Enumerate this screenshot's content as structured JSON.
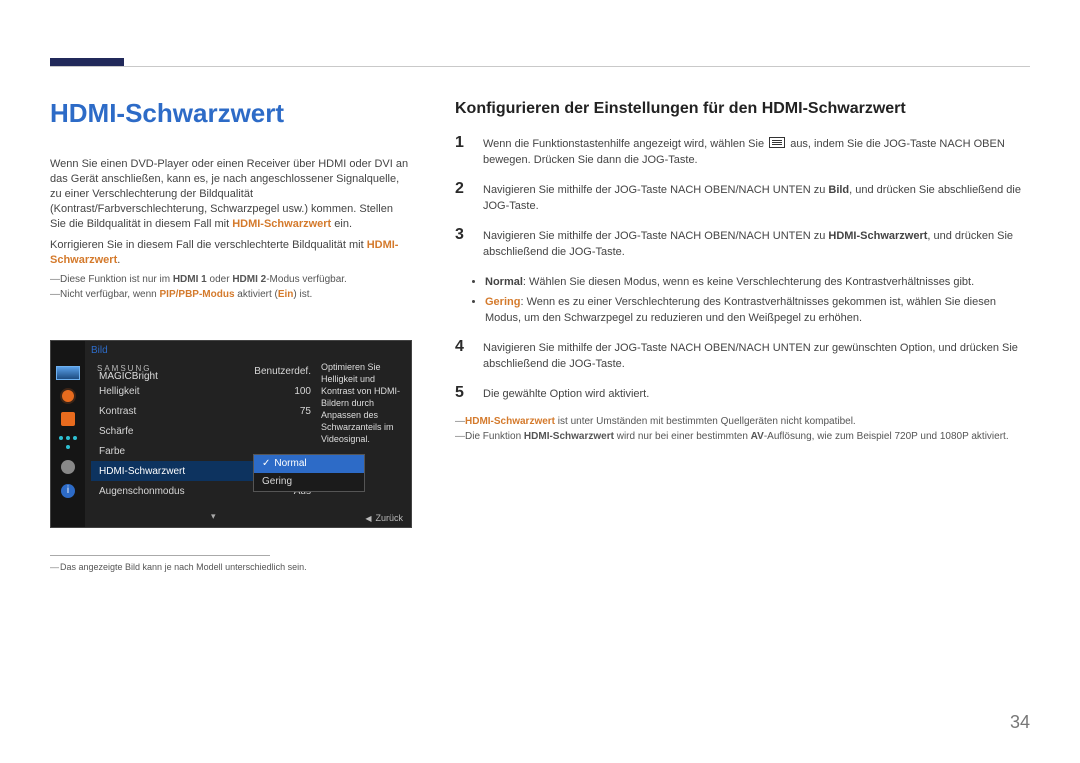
{
  "page_number": "34",
  "left": {
    "title": "HDMI-Schwarzwert",
    "intro": "Wenn Sie einen DVD-Player oder einen Receiver über HDMI oder DVI an das Gerät anschließen, kann es, je nach angeschlossener Signalquelle, zu einer Verschlechterung der Bildqualität (Kontrast/Farbverschlechterung, Schwarzpegel usw.) kommen. Stellen Sie die Bildqualität in diesem Fall mit ",
    "intro_hl": "HDMI-Schwarzwert",
    "intro_tail": " ein.",
    "intro2_a": "Korrigieren Sie in diesem Fall die verschlechterte Bildqualität mit ",
    "intro2_hl": "HDMI-Schwarzwert",
    "intro2_tail": ".",
    "note1_a": "Diese Funktion ist nur im ",
    "note1_b": "HDMI 1",
    "note1_c": " oder ",
    "note1_d": "HDMI 2",
    "note1_e": "-Modus verfügbar.",
    "note2_a": "Nicht verfügbar, wenn ",
    "note2_b": "PIP/PBP-Modus",
    "note2_c": " aktiviert (",
    "note2_d": "Ein",
    "note2_e": ") ist.",
    "caption": "Das angezeigte Bild kann je nach Modell unterschiedlich sein."
  },
  "osd": {
    "title": "Bild",
    "magic_brand": "SAMSUNG",
    "magic": "MAGICBright",
    "rows": [
      {
        "label": "",
        "value": "Benutzerdef."
      },
      {
        "label": "Helligkeit",
        "value": "100"
      },
      {
        "label": "Kontrast",
        "value": "75"
      },
      {
        "label": "Schärfe",
        "value": ""
      },
      {
        "label": "Farbe",
        "value": ""
      },
      {
        "label": "HDMI-Schwarzwert",
        "value": ""
      },
      {
        "label": "Augenschonmodus",
        "value": "Aus"
      }
    ],
    "popup": {
      "opt1": "Normal",
      "opt2": "Gering"
    },
    "desc": "Optimieren Sie Helligkeit und Kontrast von HDMI-Bildern durch Anpassen des Schwarzanteils im Videosignal.",
    "back": "Zurück"
  },
  "right": {
    "title": "Konfigurieren der Einstellungen für den HDMI-Schwarzwert",
    "steps": {
      "s1a": "Wenn die Funktionstastenhilfe angezeigt wird, wählen Sie ",
      "s1b": " aus, indem Sie die JOG-Taste NACH OBEN bewegen. Drücken Sie dann die JOG-Taste.",
      "s2a": "Navigieren Sie mithilfe der JOG-Taste NACH OBEN/NACH UNTEN zu ",
      "s2b": "Bild",
      "s2c": ", und drücken Sie abschließend die JOG-Taste.",
      "s3a": "Navigieren Sie mithilfe der JOG-Taste NACH OBEN/NACH UNTEN zu ",
      "s3b": "HDMI-Schwarzwert",
      "s3c": ", und drücken Sie abschließend die JOG-Taste.",
      "b1a": "Normal",
      "b1b": ": Wählen Sie diesen Modus, wenn es keine Verschlechterung des Kontrastverhältnisses gibt.",
      "b2a": "Gering",
      "b2b": ": Wenn es zu einer Verschlechterung des Kontrastverhältnisses gekommen ist, wählen Sie diesen Modus, um den Schwarzpegel zu reduzieren und den Weißpegel zu erhöhen.",
      "s4": "Navigieren Sie mithilfe der JOG-Taste NACH OBEN/NACH UNTEN zur gewünschten Option, und drücken Sie abschließend die JOG-Taste.",
      "s5": "Die gewählte Option wird aktiviert."
    },
    "note3_a": "HDMI-Schwarzwert",
    "note3_b": " ist unter Umständen mit bestimmten Quellgeräten nicht kompatibel.",
    "note4_a": "Die Funktion ",
    "note4_b": "HDMI-Schwarzwert",
    "note4_c": " wird nur bei einer bestimmten ",
    "note4_d": "AV",
    "note4_e": "-Auflösung, wie zum Beispiel 720P und 1080P aktiviert."
  }
}
